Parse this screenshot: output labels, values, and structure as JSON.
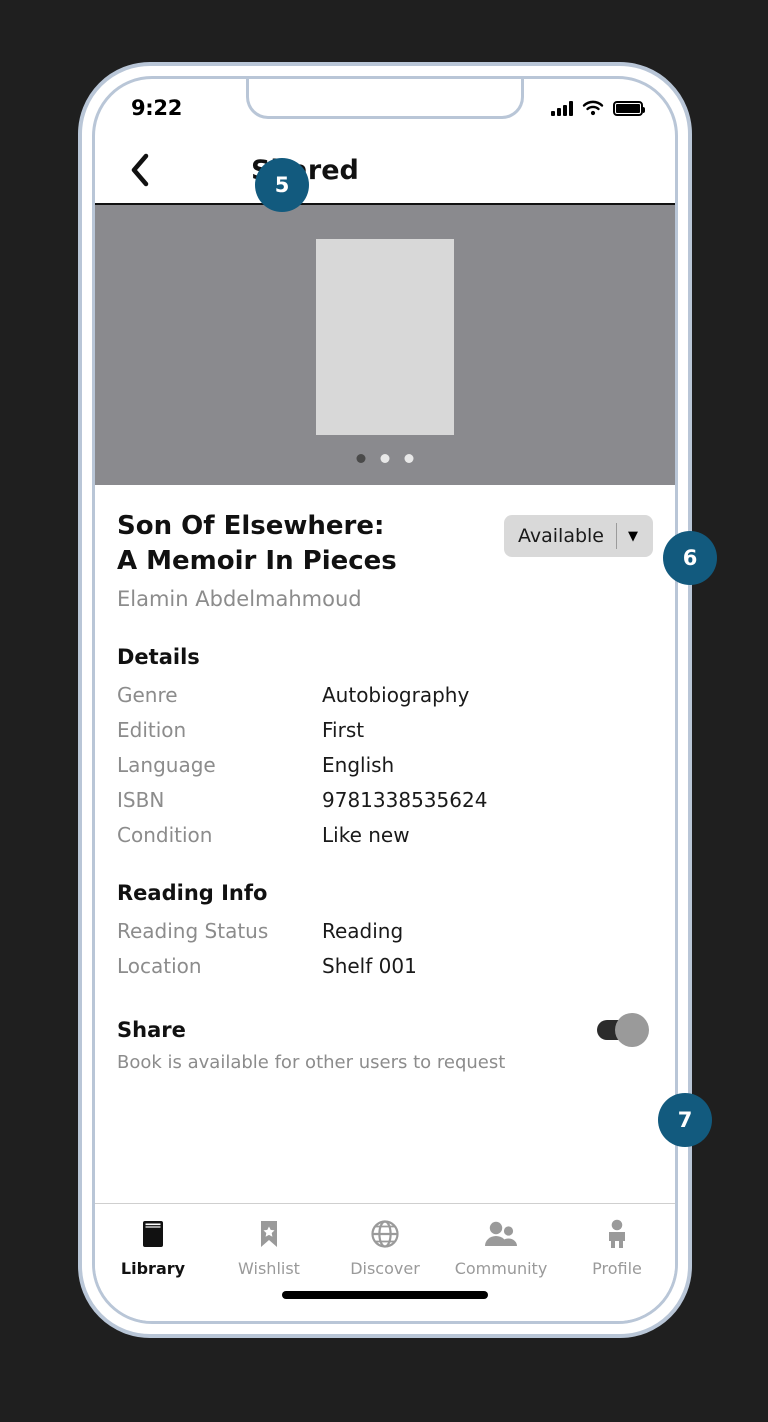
{
  "status_bar": {
    "time": "9:22",
    "signal_icon": "cellular-signal-icon",
    "wifi_icon": "wifi-icon",
    "battery_icon": "battery-full-icon"
  },
  "header": {
    "back_icon": "back-chevron-icon",
    "title": "Shared",
    "badge": "5"
  },
  "carousel": {
    "dot_count": 3,
    "active_dot_index": 0,
    "background_color": "#8a8a8e",
    "placeholder_color": "#d8d8d8"
  },
  "book": {
    "title": "Son Of Elsewhere:\nA Memoir In Pieces",
    "title_line1": "Son Of Elsewhere:",
    "title_line2": "A Memoir In Pieces",
    "author": "Elamin Abdelmahmoud",
    "availability": {
      "value": "Available",
      "caret_icon": "chevron-down-icon",
      "badge": "6"
    }
  },
  "details": {
    "heading": "Details",
    "rows": [
      {
        "label": "Genre",
        "value": "Autobiography"
      },
      {
        "label": "Edition",
        "value": "First"
      },
      {
        "label": "Language",
        "value": "English"
      },
      {
        "label": "ISBN",
        "value": "9781338535624"
      },
      {
        "label": "Condition",
        "value": "Like new"
      }
    ]
  },
  "reading_info": {
    "heading": "Reading Info",
    "rows": [
      {
        "label": "Reading Status",
        "value": "Reading"
      },
      {
        "label": "Location",
        "value": "Shelf 001"
      }
    ]
  },
  "share": {
    "title": "Share",
    "description": "Book is available for other users to request",
    "toggle_on": true,
    "badge": "7"
  },
  "tab_bar": {
    "items": [
      {
        "label": "Library",
        "icon": "book-icon",
        "active": true
      },
      {
        "label": "Wishlist",
        "icon": "bookmark-star-icon",
        "active": false
      },
      {
        "label": "Discover",
        "icon": "globe-icon",
        "active": false
      },
      {
        "label": "Community",
        "icon": "people-icon",
        "active": false
      },
      {
        "label": "Profile",
        "icon": "person-icon",
        "active": false
      }
    ]
  },
  "colors": {
    "badge": "#125a7e",
    "frame": "#b9c6d7",
    "backdrop": "#1f1f1f"
  }
}
